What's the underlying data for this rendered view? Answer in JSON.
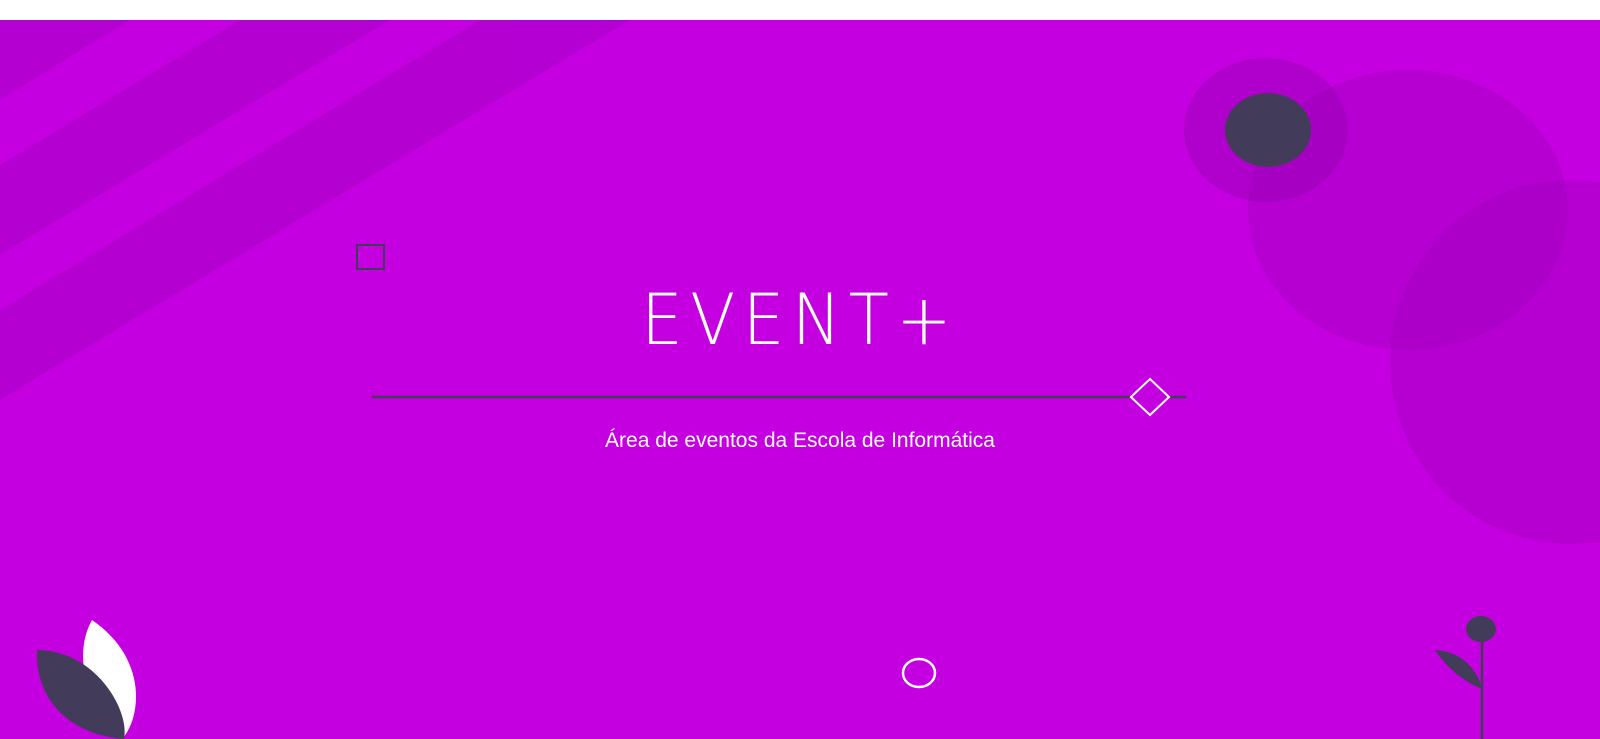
{
  "hero": {
    "logo_text": "EVENT+",
    "subtitle": "Área de eventos da Escola de Informática"
  },
  "colors": {
    "background": "#c500e0",
    "stripe": "#a800c8",
    "circle_dark": "#9a00b8",
    "navy": "#433b5a",
    "white": "#ffffff",
    "page_top": "#ffffff"
  },
  "decorations": [
    "diagonal-stripes",
    "translucent-circles",
    "navy-dot",
    "outline-square",
    "divider-line",
    "diamond-icon",
    "outline-circle",
    "leaf-plant",
    "flower-plant"
  ]
}
